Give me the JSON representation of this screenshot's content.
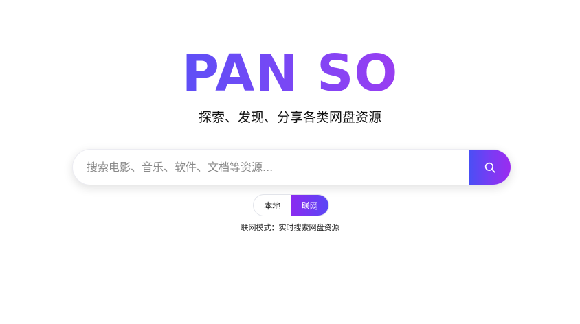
{
  "logo": {
    "text": "PAN SO"
  },
  "tagline": "探索、发现、分享各类网盘资源",
  "search": {
    "placeholder": "搜索电影、音乐、软件、文档等资源...",
    "value": "",
    "button_icon": "search-icon"
  },
  "mode_toggle": {
    "options": [
      {
        "label": "本地",
        "active": false
      },
      {
        "label": "联网",
        "active": true
      }
    ],
    "description": "联网模式：实时搜索网盘资源"
  },
  "colors": {
    "gradient_start": "#3358f4",
    "gradient_end": "#a020f0"
  }
}
